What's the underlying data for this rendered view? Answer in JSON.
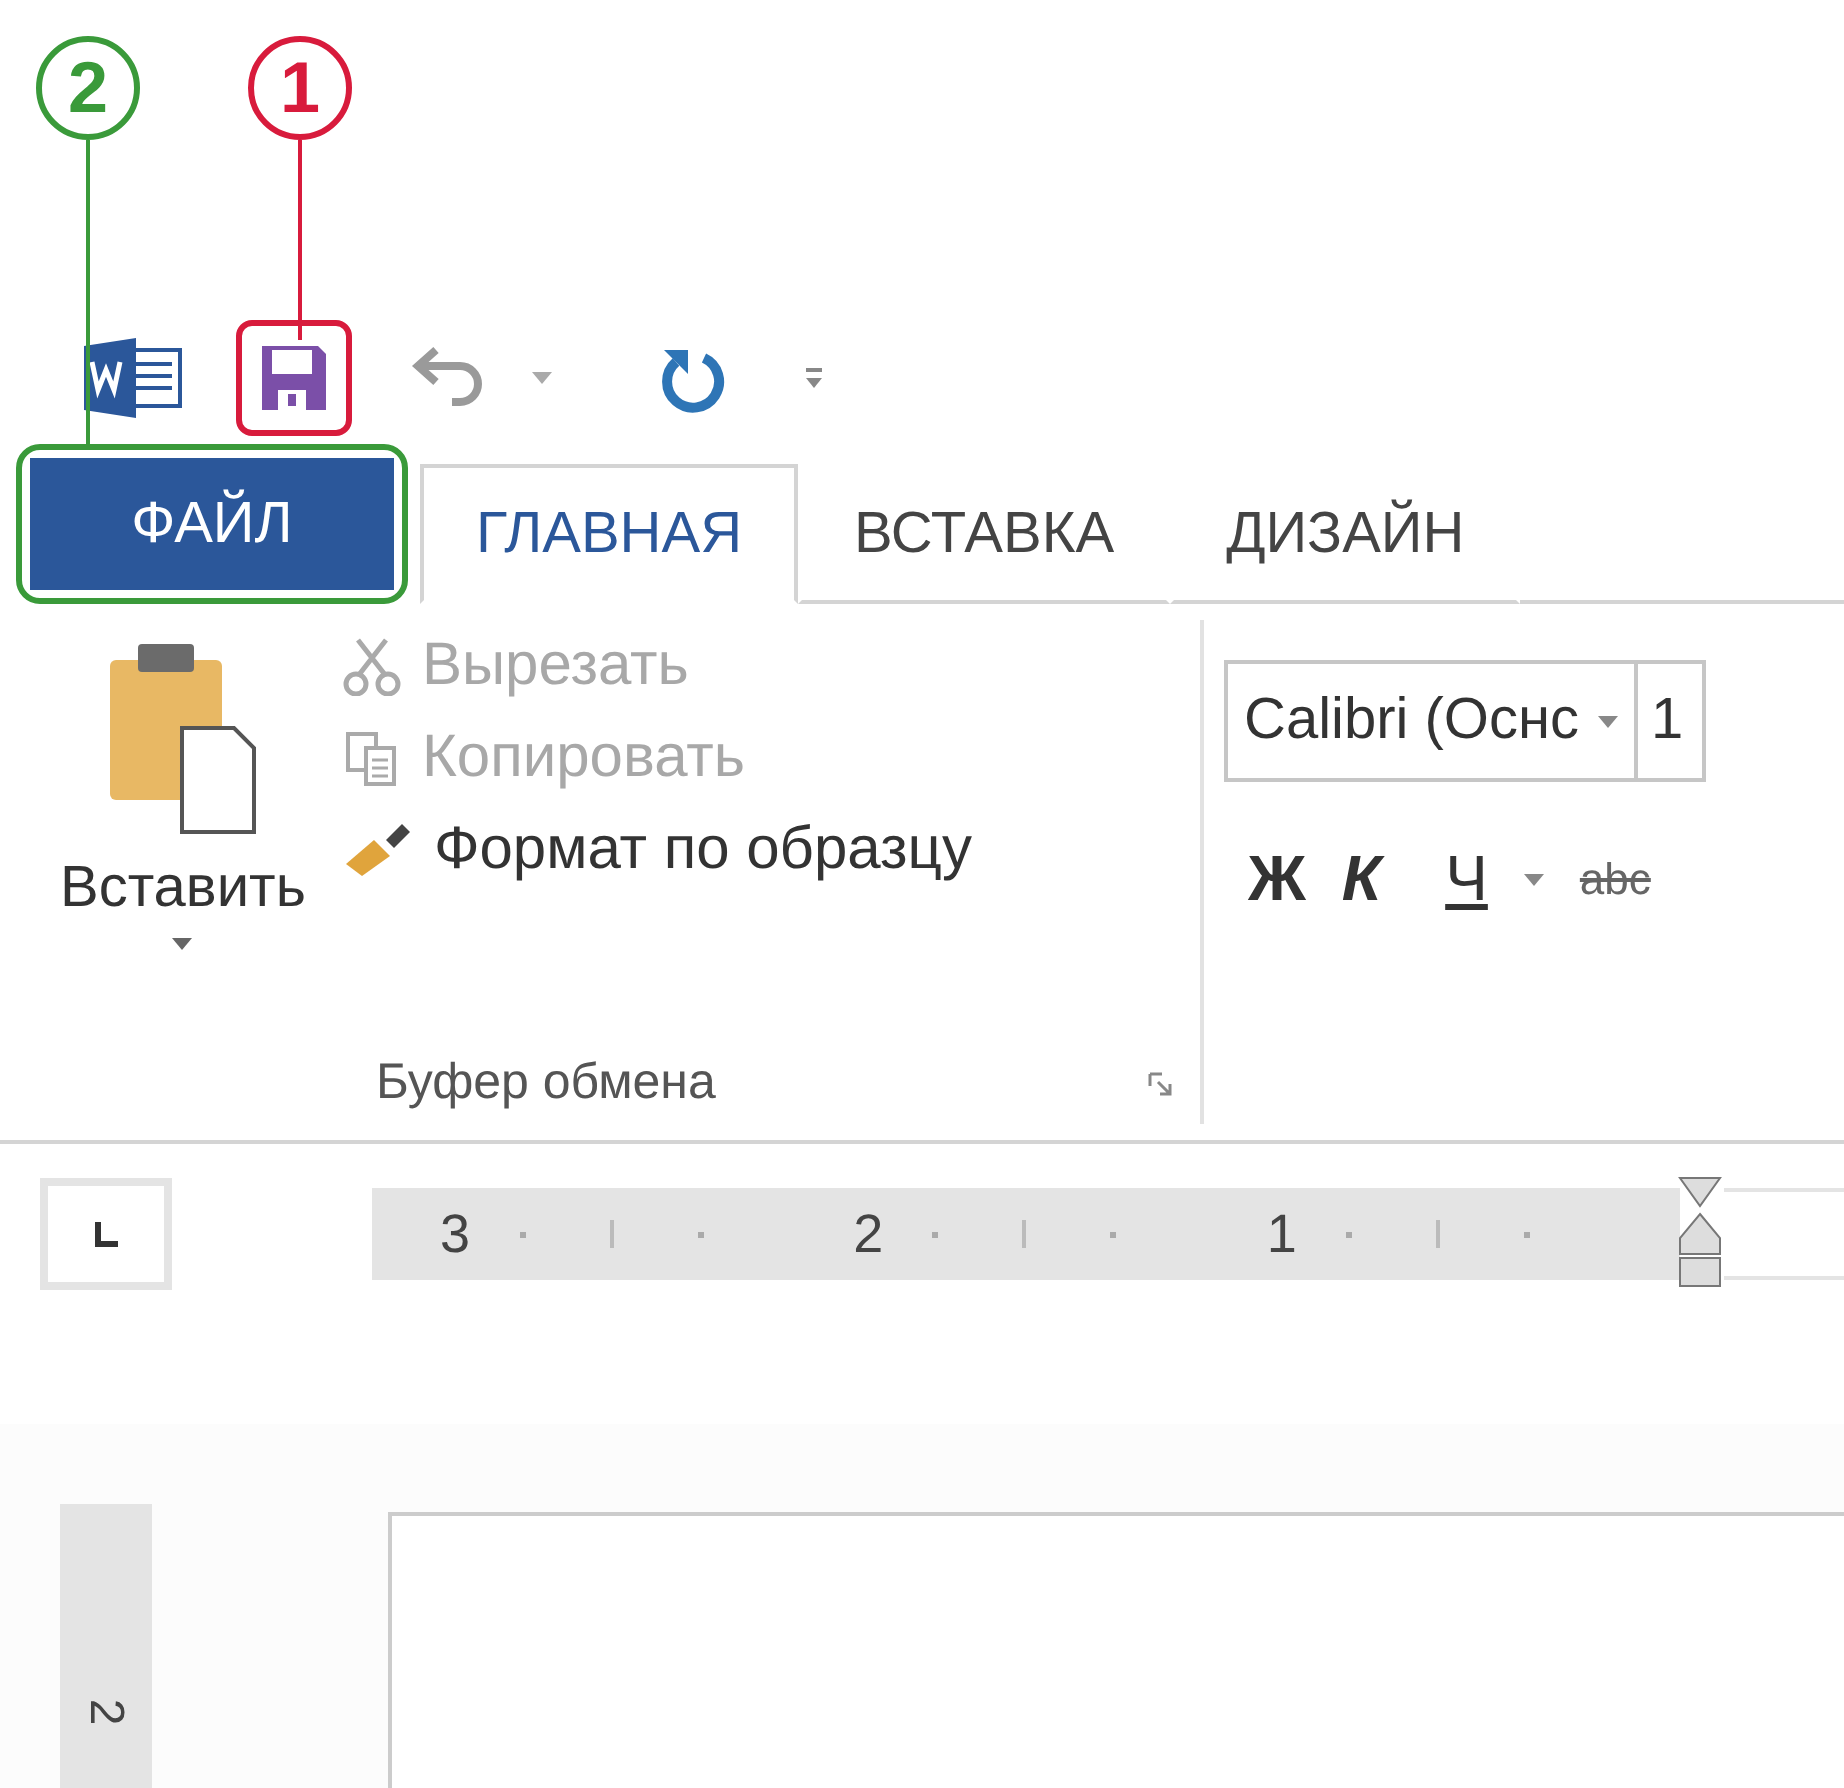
{
  "callouts": [
    {
      "number": "2",
      "color": "#3a9a3a",
      "kind": "tab"
    },
    {
      "number": "1",
      "color": "#d81b3c",
      "kind": "button"
    }
  ],
  "tabs": [
    {
      "label": "ФАЙЛ",
      "kind": "file",
      "selected": false
    },
    {
      "label": "ГЛАВНАЯ",
      "kind": "tab",
      "selected": true
    },
    {
      "label": "ВСТАВКА",
      "kind": "tab",
      "selected": false
    },
    {
      "label": "ДИЗАЙН",
      "kind": "tab",
      "selected": false
    }
  ],
  "clipboard": {
    "paste": "Вставить",
    "group_label": "Буфер обмена",
    "commands": [
      {
        "label": "Вырезать",
        "kind": "cut",
        "disabled": true
      },
      {
        "label": "Копировать",
        "kind": "copy",
        "disabled": true
      },
      {
        "label": "Формат по образцу",
        "kind": "painter",
        "disabled": false
      }
    ]
  },
  "font": {
    "name": "Calibri (Оснс",
    "size": "1",
    "buttons": [
      {
        "label": "Ж",
        "kind": "bold"
      },
      {
        "label": "К",
        "kind": "italic"
      },
      {
        "label": "Ч",
        "kind": "underline"
      },
      {
        "label": "abc",
        "kind": "strike"
      }
    ]
  },
  "ruler": {
    "numbers": [
      "3",
      "2",
      "1"
    ]
  },
  "vertical_ruler": {
    "numbers": [
      "2"
    ]
  }
}
